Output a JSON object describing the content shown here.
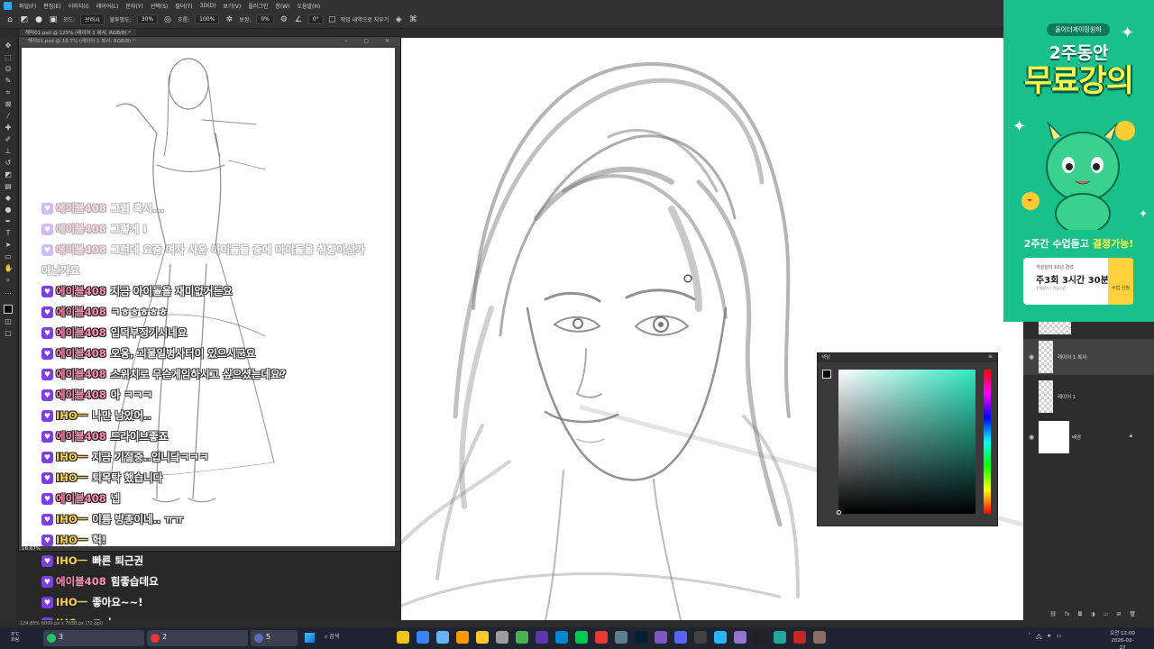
{
  "menu": [
    "파일(F)",
    "편집(E)",
    "이미지(I)",
    "레이어(L)",
    "문자(Y)",
    "선택(S)",
    "필터(T)",
    "3D(D)",
    "보기(V)",
    "플러그인",
    "창(W)",
    "도움말(H)"
  ],
  "options": {
    "mode_label": "모드:",
    "mode_value": "브러시",
    "opacity_label": "불투명도:",
    "opacity_value": "30%",
    "flow_label": "흐름:",
    "flow_value": "100%",
    "smooth_label": "보정:",
    "smooth_value": "0%",
    "angle_value": "0°",
    "history_label": "작업 내역으로 지우기"
  },
  "tab": {
    "label": "해적01.psd @ 125% (레이어 1 복사, RGB/8) *"
  },
  "docwin": {
    "title": "해적01.psd @ 16.7% (레이어 1 복사, RGB/8) *",
    "zoom": "16.67%"
  },
  "chat": [
    {
      "user": "에이블408",
      "text": "그럼 혹시...",
      "style": "u1",
      "faded": true
    },
    {
      "user": "에이블408",
      "text": "그렇게 I",
      "style": "u1",
      "faded": true
    },
    {
      "user": "에이블408",
      "text": "그런데 요즘 여자 사운 아이돌들 중에 아이돌을 취향이신가 아닌가요",
      "style": "u1",
      "faded": true,
      "wrap": true
    },
    {
      "user": "에이블408",
      "text": "지금 아이돌을 재미없거든요",
      "style": "u1",
      "faded": false
    },
    {
      "user": "에이블408",
      "text": "ㅋㅎㅎㅎㅎㅎ",
      "style": "u1",
      "faded": false
    },
    {
      "user": "에이블408",
      "text": "입덕부정기시네요",
      "style": "u1",
      "faded": false
    },
    {
      "user": "에이블408",
      "text": "오옹, 괴물일병사터이 있으시군요",
      "style": "u1",
      "faded": false
    },
    {
      "user": "에이블408",
      "text": "스위치로 무슨게임하시고 싶으셨는데요?",
      "style": "u1",
      "faded": false
    },
    {
      "user": "에이블408",
      "text": "아 ㅋㅋㅋ",
      "style": "u1",
      "faded": false
    },
    {
      "user": "IHO一",
      "text": "나만 남았어..",
      "style": "u2",
      "faded": false
    },
    {
      "user": "에이블408",
      "text": "드라이브좋죠",
      "style": "u1",
      "faded": false
    },
    {
      "user": "IHO一",
      "text": "지금 기절중..입니닼ㅋㅋㅋ",
      "style": "u2",
      "faded": false
    },
    {
      "user": "IHO一",
      "text": "퇴목탁 했습니다",
      "style": "u2",
      "faded": false
    },
    {
      "user": "에이블408",
      "text": "넵",
      "style": "u1",
      "faded": false
    },
    {
      "user": "IHO一",
      "text": "이름 방종이네.. ㅠㅠ",
      "style": "u2",
      "faded": false
    },
    {
      "user": "IHO一",
      "text": "헉!",
      "style": "u2",
      "faded": false
    },
    {
      "user": "IHO一",
      "text": "빠른 퇴근권",
      "style": "u2",
      "faded": false
    },
    {
      "user": "에이블408",
      "text": "힘좋습데요",
      "style": "u1",
      "faded": false
    },
    {
      "user": "IHO一",
      "text": "좋아요~~!",
      "style": "u2",
      "faded": false
    },
    {
      "user": "IHO一",
      "text": "ㅋ.ㅑ",
      "style": "u2",
      "faded": false
    }
  ],
  "color_panel": {
    "title": "색상",
    "accent": "#2ee8c0"
  },
  "layers": [
    {
      "name": "레이어 1 복사",
      "selected": true
    },
    {
      "name": "레이어 1",
      "selected": false
    },
    {
      "name": "배경",
      "selected": false
    }
  ],
  "ad": {
    "pill": "울이더게이밍원하",
    "headline": "2주동안",
    "title": "무료강의",
    "banner_prefix": "2주간 수업듣고",
    "banner_highlight": "결정가능!",
    "card_small": "개설원하 10년 경력",
    "card_head": "주3회 3시간 30분",
    "card_tiny": "수업방식 / 학습시간",
    "card_btn": "수업 신청"
  },
  "status": {
    "text": "124.85%   6000 px x 7038 px (72 ppi)"
  },
  "taskbar": {
    "weather_temp": "3°C",
    "weather_desc": "흐림",
    "group1": "3",
    "group2": "2",
    "group3": "5",
    "search": "검색",
    "time": "오전 12:00",
    "date": "2026-02-27"
  }
}
